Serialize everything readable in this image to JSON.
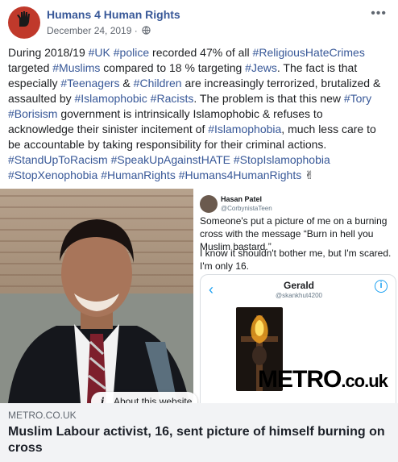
{
  "post": {
    "page_name": "Humans 4 Human Rights",
    "date": "December 24, 2019",
    "visibility_icon": "globe-icon",
    "more_icon": "more-options-icon"
  },
  "text": {
    "s01": "During 2018/19 ",
    "t01": "#UK",
    "s02": " ",
    "t02": "#police",
    "s03": " recorded 47% of all ",
    "t03": "#ReligiousHateCrimes",
    "s04": " targeted ",
    "t04": "#Muslims",
    "s05": " compared to 18 % targeting ",
    "t05": "#Jews",
    "s06": ". The fact is that especially ",
    "t06": "#Teenagers",
    "s07": " & ",
    "t07": "#Children",
    "s08": " are increasingly terrorized, brutalized & assaulted by ",
    "t08": "#Islamophobic",
    "s09": " ",
    "t09": "#Racists",
    "s10": ". The problem is that this new ",
    "t10": "#Tory",
    "s11": " ",
    "t11": "#Borisism",
    "s12": " government is intrinsically Islamophobic & refuses to acknowledge their sinister incitement of ",
    "t12": "#Islamophobia",
    "s13": ", much less care to be accountable by taking responsibility for their criminal actions. ",
    "t13": "#StandUpToRacism",
    "s14": " ",
    "t14": "#SpeakUpAgainstHATE",
    "s15": " ",
    "t15": "#StopIslamophobia",
    "s16": " ",
    "t16": "#StopXenophobia",
    "s17": " ",
    "t17": "#HumanRights",
    "s18": " ",
    "t18": "#Humans4HumanRights",
    "emoji": " ✌"
  },
  "image": {
    "tweet_name": "Hasan Patel",
    "tweet_handle": "@CorbynistaTeen",
    "tweet_text_1": "Someone's put a picture of me on a burning cross with the message “Burn in hell you Muslim bastard.”",
    "tweet_text_2": "I know it shouldn't bother me, but I'm scared. I'm only 16.",
    "phone_name": "Gerald",
    "phone_handle": "@skankhut4200",
    "metro_logo": "METRO",
    "metro_suffix": ".co.uk",
    "about_button": "About this website"
  },
  "link": {
    "domain": "METRO.CO.UK",
    "title": "Muslim Labour activist, 16, sent picture of himself burning on cross"
  },
  "colors": {
    "hashtag": "#385898",
    "page_name": "#385898",
    "footer_bg": "#f2f3f5"
  }
}
